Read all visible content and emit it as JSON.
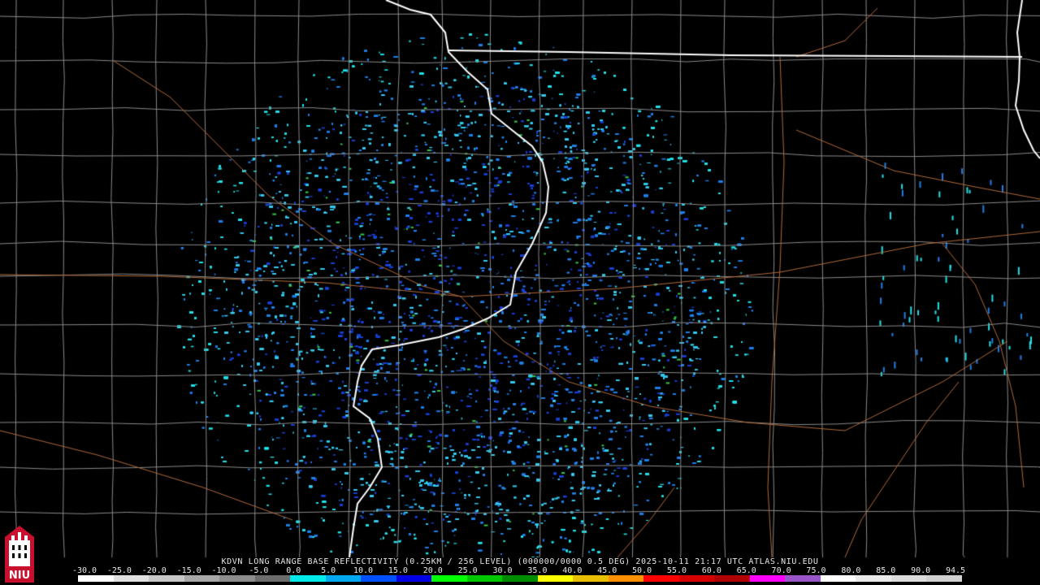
{
  "caption": {
    "station": "KDVN",
    "product": "LONG RANGE BASE REFLECTIVITY (0.25KM / 256 LEVEL) (000000/0000 0.5 DEG)",
    "timestamp": "2025-10-11 21:17 UTC",
    "source": "ATLAS.NIU.EDU"
  },
  "logo": {
    "text": "NIU",
    "colors": {
      "red": "#c8102e",
      "white": "#ffffff",
      "black": "#000000"
    }
  },
  "colorbar": {
    "labels": [
      "-30.0",
      "-25.0",
      "-20.0",
      "-15.0",
      "-10.0",
      "-5.0",
      "0.0",
      "5.0",
      "10.0",
      "15.0",
      "20.0",
      "25.0",
      "30.0",
      "35.0",
      "40.0",
      "45.0",
      "50.0",
      "55.0",
      "60.0",
      "65.0",
      "70.0",
      "75.0",
      "80.0",
      "85.0",
      "90.0",
      "94.5"
    ],
    "colors": [
      "#ffffff",
      "#e0e0e0",
      "#c8c8c8",
      "#a8a8a8",
      "#8c8c8c",
      "#6c6c6c",
      "#00eaea",
      "#00a8f0",
      "#0050ff",
      "#0000e6",
      "#00ff00",
      "#00c800",
      "#008c00",
      "#ffff00",
      "#e8c000",
      "#ff9000",
      "#ff0000",
      "#d60000",
      "#b00000",
      "#ff00ff",
      "#9a55c9",
      "#ffffff",
      "#eaeaea",
      "#dcdcdc",
      "#d0d0d0"
    ]
  },
  "map": {
    "radar_colors": {
      "light": "#35c9ee",
      "mid": "#1f7fe6",
      "dark": "#1a3fd0",
      "green": "#38c84a",
      "cyan": "#22e0e8"
    },
    "line_colors": {
      "state": "#ffffff",
      "county": "#8a8a8a",
      "road": "#b06a3c"
    }
  }
}
